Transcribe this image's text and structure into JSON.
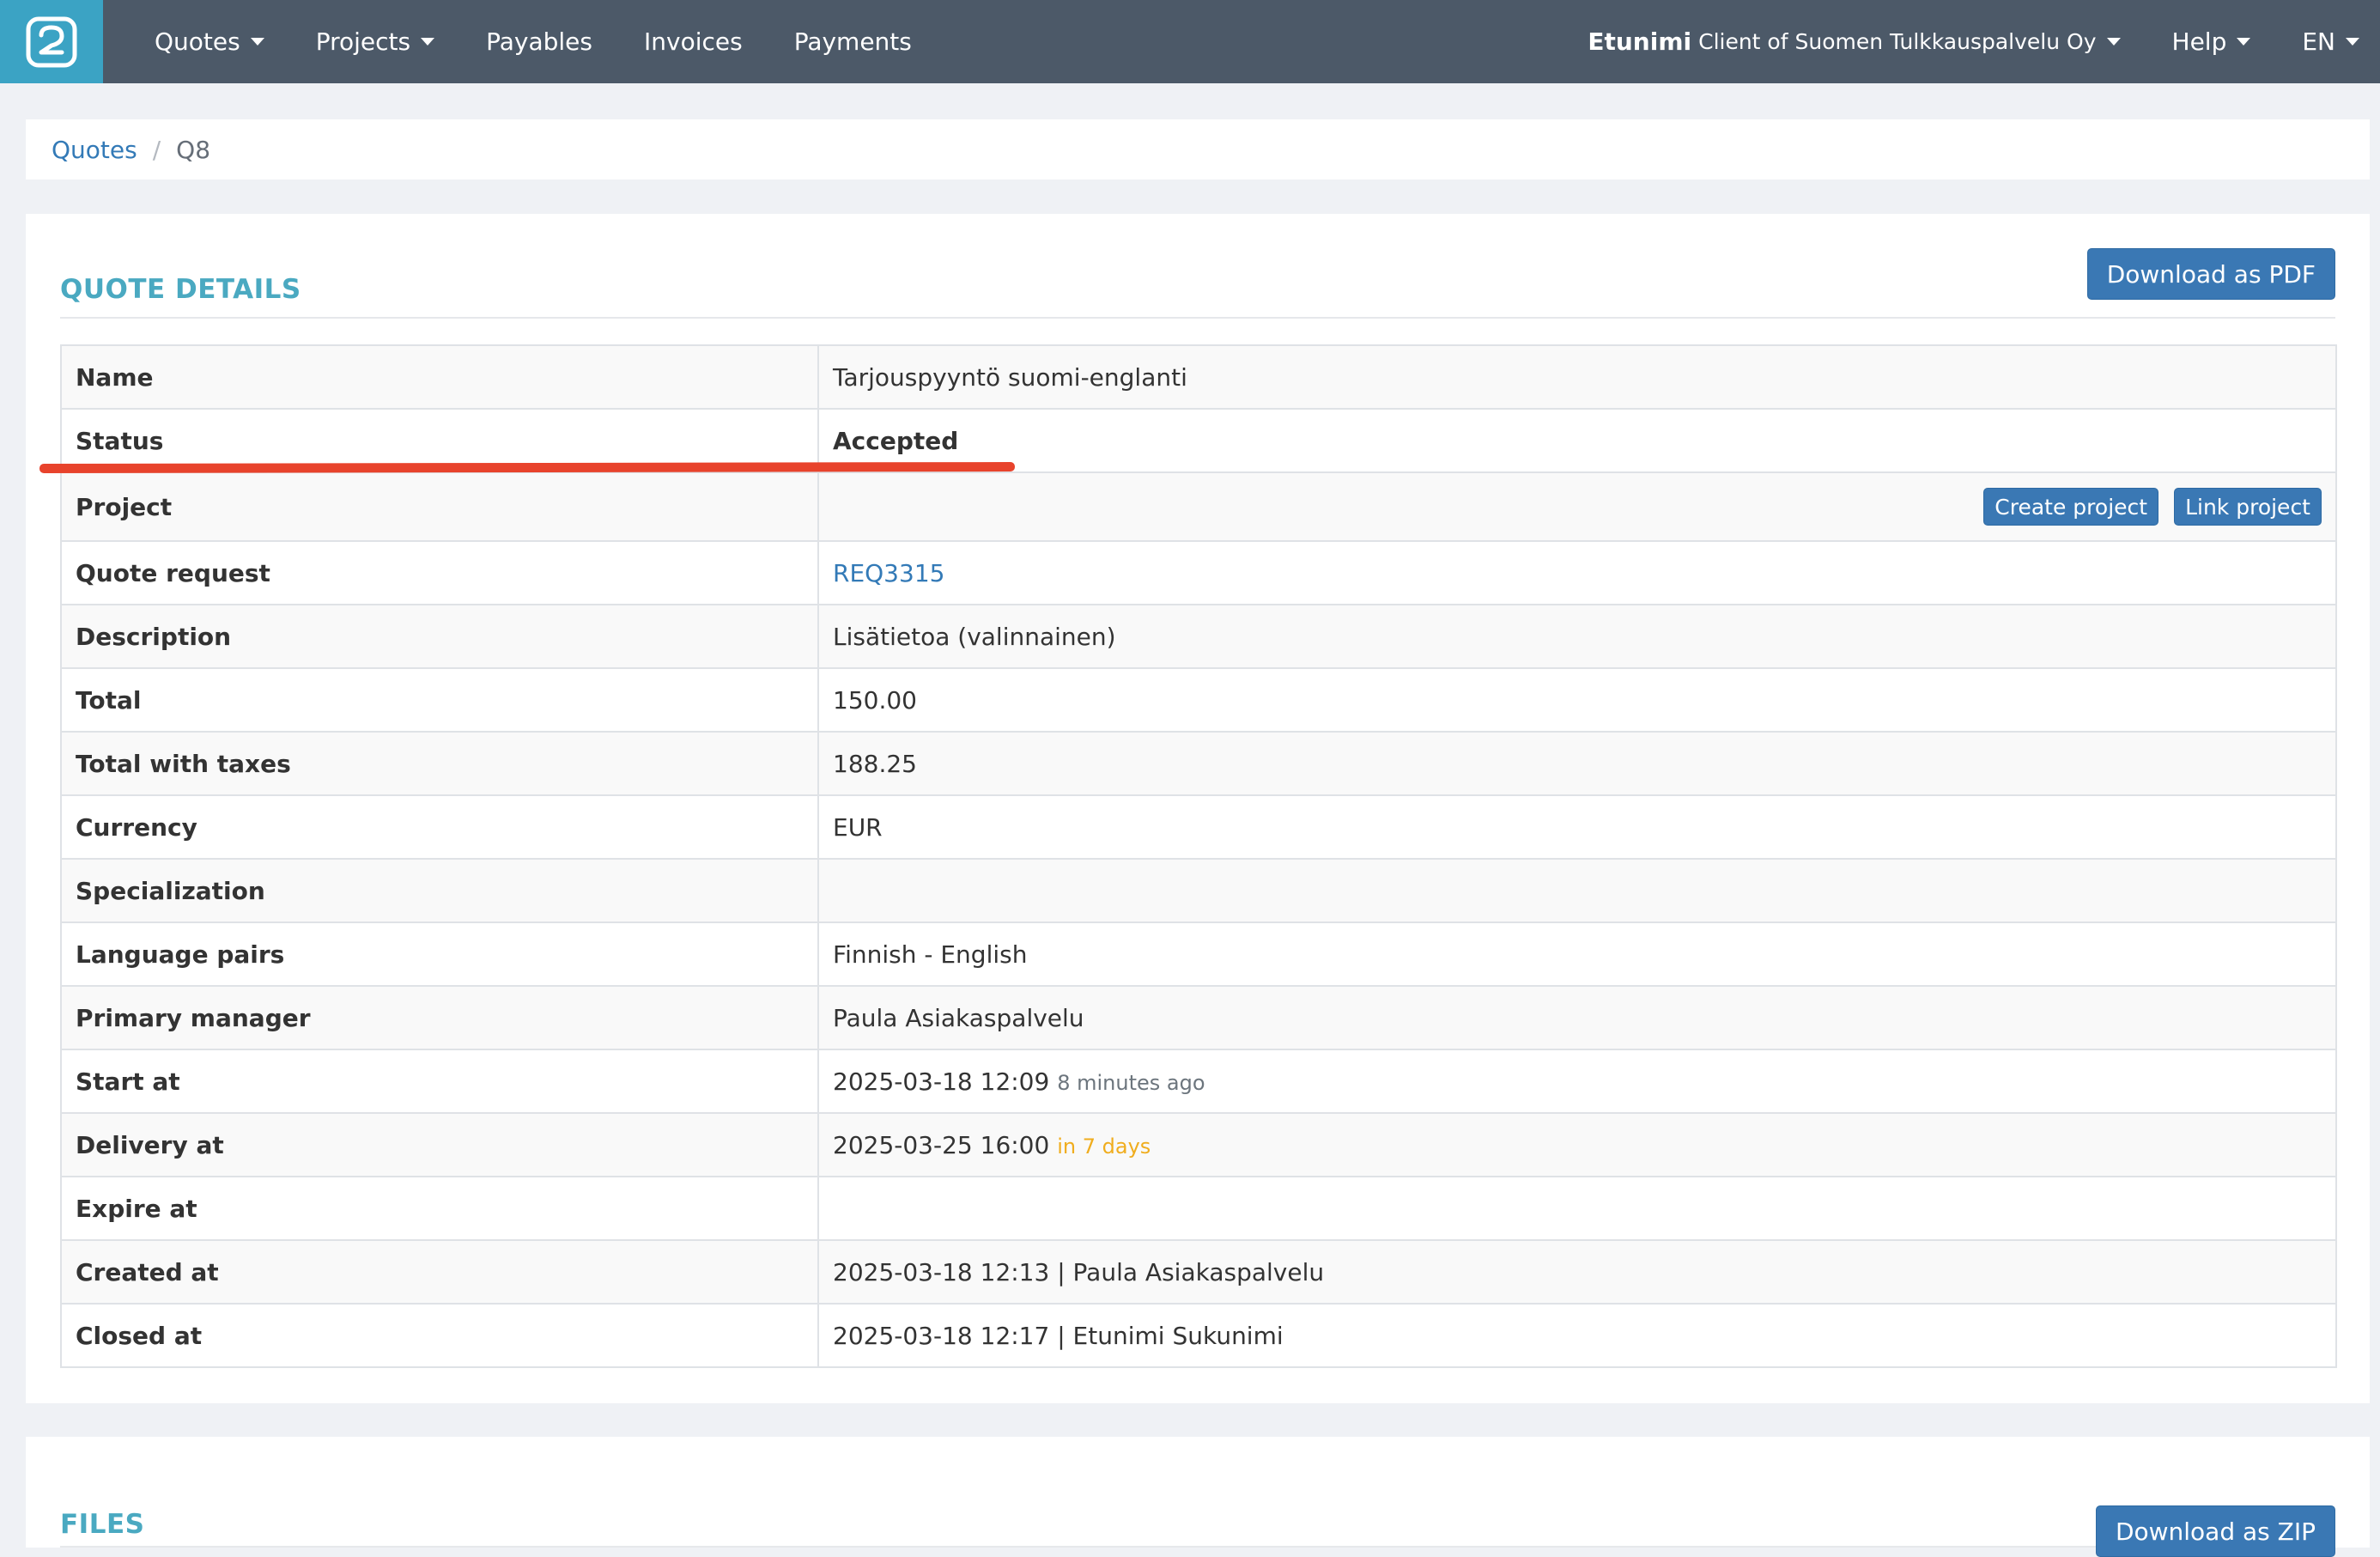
{
  "navbar": {
    "logo_icon": "app-logo-icon",
    "items": [
      {
        "label": "Quotes",
        "dropdown": true
      },
      {
        "label": "Projects",
        "dropdown": true
      },
      {
        "label": "Payables",
        "dropdown": false
      },
      {
        "label": "Invoices",
        "dropdown": false
      },
      {
        "label": "Payments",
        "dropdown": false
      }
    ],
    "user": {
      "name": "Etunimi",
      "org": "Client of Suomen Tulkkauspalvelu Oy"
    },
    "help_label": "Help",
    "language_label": "EN",
    "colors": {
      "background": "#4c5968",
      "brand": "#3ba3c4"
    }
  },
  "breadcrumb": {
    "root": "Quotes",
    "separator": "/",
    "current": "Q8"
  },
  "quote_details": {
    "title": "QUOTE DETAILS",
    "download_label": "Download as PDF",
    "rows": {
      "name": {
        "label": "Name",
        "value": "Tarjouspyyntö suomi-englanti"
      },
      "status": {
        "label": "Status",
        "value": "Accepted"
      },
      "project": {
        "label": "Project",
        "create_label": "Create project",
        "link_label": "Link project"
      },
      "quote_request": {
        "label": "Quote request",
        "value": "REQ3315"
      },
      "description": {
        "label": "Description",
        "value": "Lisätietoa (valinnainen)"
      },
      "total": {
        "label": "Total",
        "value": "150.00"
      },
      "total_taxes": {
        "label": "Total with taxes",
        "value": "188.25"
      },
      "currency": {
        "label": "Currency",
        "value": "EUR"
      },
      "specialization": {
        "label": "Specialization",
        "value": ""
      },
      "language_pairs": {
        "label": "Language pairs",
        "value": "Finnish - English"
      },
      "primary_manager": {
        "label": "Primary manager",
        "value": "Paula Asiakaspalvelu"
      },
      "start_at": {
        "label": "Start at",
        "value": "2025-03-18 12:09",
        "relative": "8 minutes ago"
      },
      "delivery_at": {
        "label": "Delivery at",
        "value": "2025-03-25 16:00",
        "relative": "in 7 days"
      },
      "expire_at": {
        "label": "Expire at",
        "value": ""
      },
      "created_at": {
        "label": "Created at",
        "value": "2025-03-18 12:13 | Paula Asiakaspalvelu"
      },
      "closed_at": {
        "label": "Closed at",
        "value": "2025-03-18 12:17 | Etunimi Sukunimi"
      }
    },
    "colors": {
      "title": "#4aa9c1",
      "button": "#3a78b4",
      "annotation": "#e8432c",
      "warning": "#f0ad1e"
    }
  },
  "files": {
    "title": "FILES",
    "download_label": "Download as ZIP"
  }
}
